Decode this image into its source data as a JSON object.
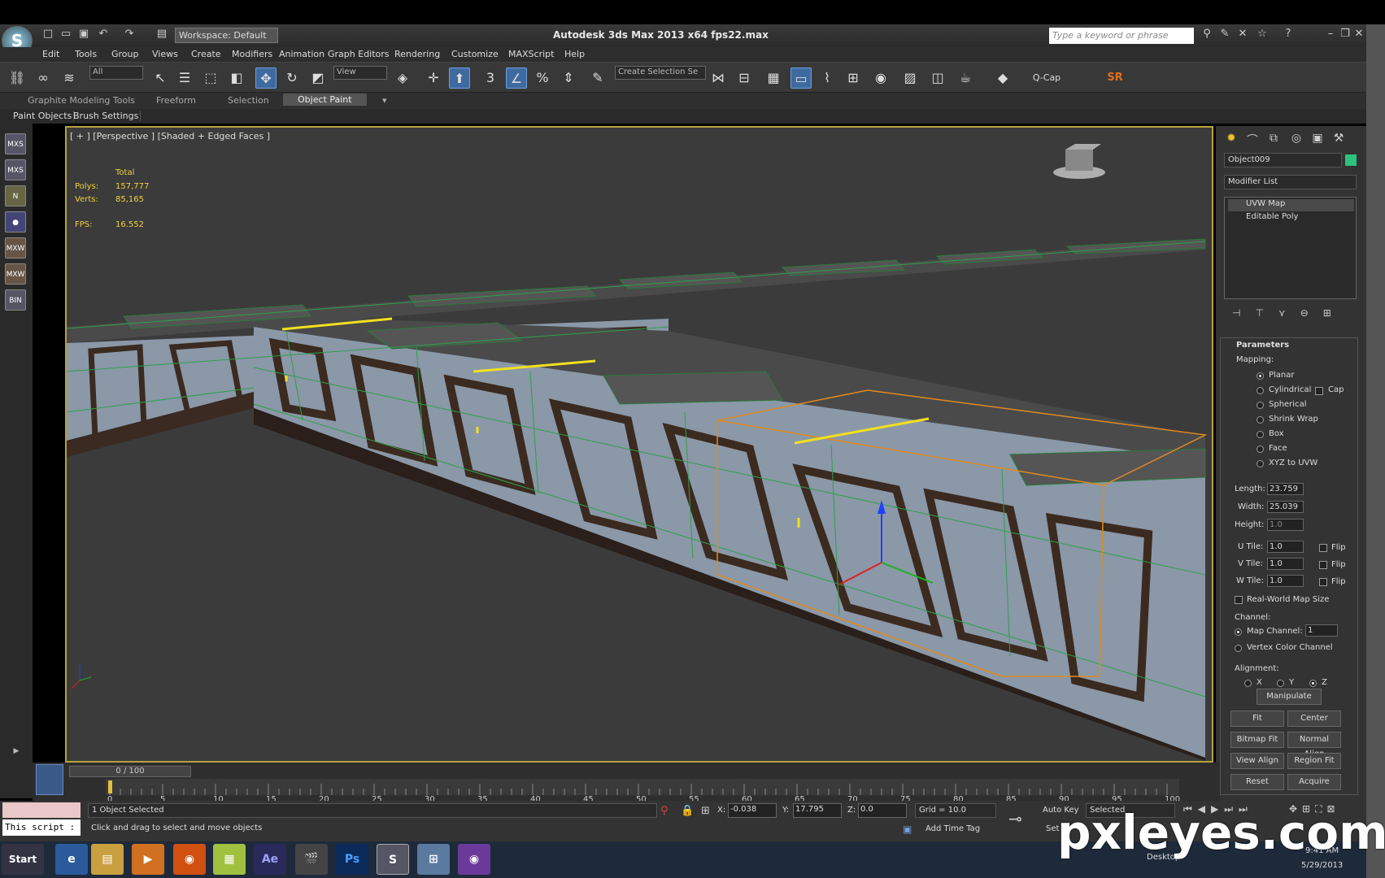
{
  "titlebar": {
    "workspace": "Workspace: Default",
    "title": "Autodesk 3ds Max  2013 x64      fps22.max",
    "search_placeholder": "Type a keyword or phrase"
  },
  "menu": [
    "Edit",
    "Tools",
    "Group",
    "Views",
    "Create",
    "Modifiers",
    "Animation",
    "Graph Editors",
    "Rendering",
    "Customize",
    "MAXScript",
    "Help"
  ],
  "toolbar": {
    "filter": "All",
    "refcoord": "View",
    "selection_set": "Create Selection Se",
    "qcap": "Q-Cap",
    "sr": "SR"
  },
  "ribbon": {
    "tabs": [
      "Graphite Modeling Tools",
      "Freeform",
      "Selection",
      "Object Paint"
    ],
    "active_tab": "Object Paint",
    "subtabs": [
      "Paint Objects",
      "Brush Settings"
    ]
  },
  "viewport": {
    "label": "[ + ] [Perspective ] [Shaded + Edged Faces ]",
    "stats_header": "Total",
    "polys_label": "Polys:",
    "polys_value": "157,777",
    "verts_label": "Verts:",
    "verts_value": "85,165",
    "fps_label": "FPS:",
    "fps_value": "16.552"
  },
  "command_panel": {
    "object_name": "Object009",
    "object_color": "#2ec27e",
    "modifier_list": "Modifier List",
    "stack": [
      "UVW Map",
      "Editable Poly"
    ]
  },
  "parameters": {
    "title": "Parameters",
    "mapping_label": "Mapping:",
    "mapping_options": [
      "Planar",
      "Cylindrical",
      "Spherical",
      "Shrink Wrap",
      "Box",
      "Face",
      "XYZ to UVW"
    ],
    "mapping_selected": "Planar",
    "cap_label": "Cap",
    "length_label": "Length:",
    "length_value": "23.759",
    "width_label": "Width:",
    "width_value": "25.039",
    "height_label": "Height:",
    "height_value": "1.0",
    "utile_label": "U Tile:",
    "utile_value": "1.0",
    "vtile_label": "V Tile:",
    "vtile_value": "1.0",
    "wtile_label": "W Tile:",
    "wtile_value": "1.0",
    "flip_label": "Flip",
    "realworld_label": "Real-World Map Size",
    "channel_label": "Channel:",
    "map_channel_label": "Map Channel:",
    "map_channel_value": "1",
    "vertex_color_label": "Vertex Color Channel",
    "alignment_label": "Alignment:",
    "axes": [
      "X",
      "Y",
      "Z"
    ],
    "axis_selected": "Z",
    "buttons": {
      "manipulate": "Manipulate",
      "fit": "Fit",
      "center": "Center",
      "bitmap_fit": "Bitmap Fit",
      "normal_align": "Normal Align",
      "view_align": "View Align",
      "region_fit": "Region Fit",
      "reset": "Reset",
      "acquire": "Acquire"
    }
  },
  "timeline": {
    "frame_display": "0 / 100",
    "ticks": [
      "0",
      "5",
      "10",
      "15",
      "20",
      "25",
      "30",
      "35",
      "40",
      "45",
      "50",
      "55",
      "60",
      "65",
      "70",
      "75",
      "80",
      "85",
      "90",
      "95",
      "100"
    ]
  },
  "status": {
    "script_label": "This script :",
    "selected": "1 Object Selected",
    "prompt": "Click and drag to select and move objects",
    "x_label": "X:",
    "x_value": "-0.038",
    "y_label": "Y:",
    "y_value": "17.795",
    "z_label": "Z:",
    "z_value": "0.0",
    "grid": "Grid = 10.0",
    "auto_key": "Auto Key",
    "set_key_mode": "Selected",
    "set": "Set",
    "add_time_tag": "Add Time Tag"
  },
  "taskbar": {
    "start": "Start",
    "desktop": "Desktop",
    "time": "9:41 AM",
    "date": "5/29/2013"
  },
  "watermark": "pxleyes.com"
}
